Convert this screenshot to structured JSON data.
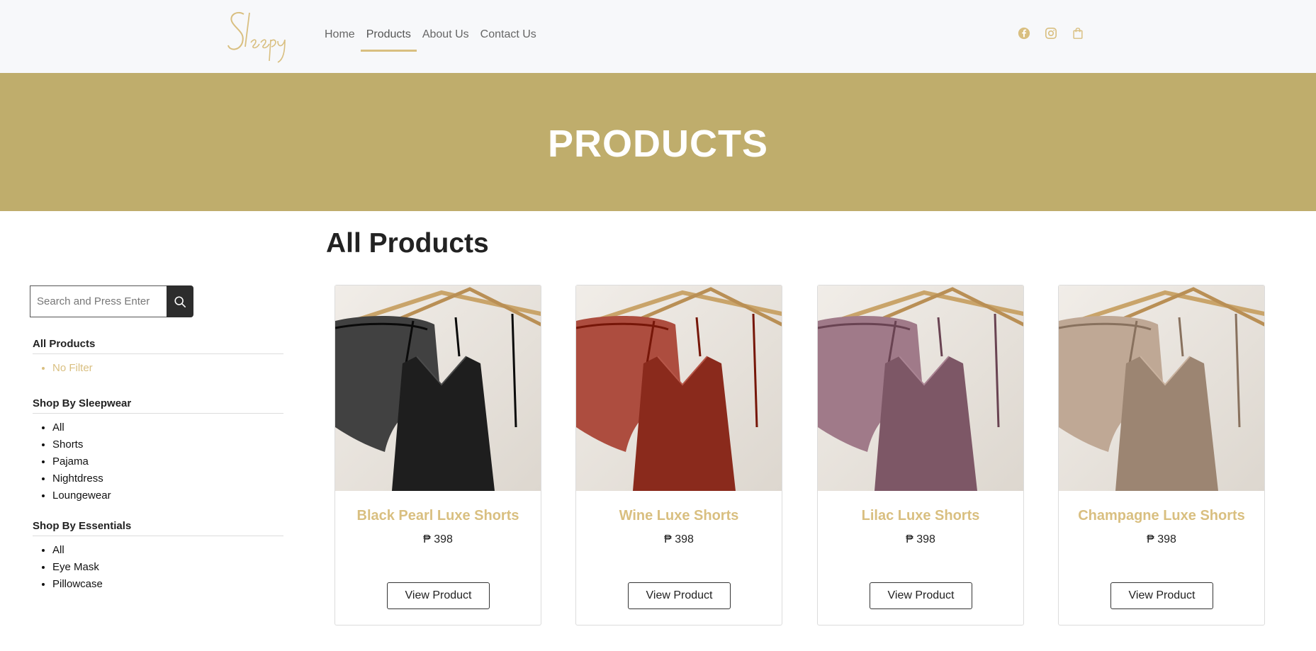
{
  "header": {
    "logo_text": "Sleepy",
    "nav": [
      {
        "label": "Home"
      },
      {
        "label": "Products"
      },
      {
        "label": "About Us"
      },
      {
        "label": "Contact Us"
      }
    ],
    "icons": [
      "facebook-icon",
      "instagram-icon",
      "shopping-bag-icon"
    ]
  },
  "banner": {
    "title": "PRODUCTS"
  },
  "sidebar": {
    "search_placeholder": "Search and Press Enter",
    "groups": [
      {
        "title": "All Products",
        "items": [
          "No Filter"
        ]
      },
      {
        "title": "Shop By Sleepwear",
        "items": [
          "All",
          "Shorts",
          "Pajama",
          "Nightdress",
          "Loungewear"
        ]
      },
      {
        "title": "Shop By Essentials",
        "items": [
          "All",
          "Eye Mask",
          "Pillowcase"
        ]
      }
    ]
  },
  "main": {
    "title": "All Products",
    "products": [
      {
        "name": "Black Pearl Luxe Shorts",
        "price": "₱ 398",
        "button": "View Product",
        "color": "#1e1e1e"
      },
      {
        "name": "Wine Luxe Shorts",
        "price": "₱ 398",
        "button": "View Product",
        "color": "#8a2a1c"
      },
      {
        "name": "Lilac Luxe Shorts",
        "price": "₱ 398",
        "button": "View Product",
        "color": "#7d5766"
      },
      {
        "name": "Champagne Luxe Shorts",
        "price": "₱ 398",
        "button": "View Product",
        "color": "#9c8572"
      }
    ]
  },
  "colors": {
    "accent": "#d9bf80",
    "banner": "#bfad6c",
    "header_bg": "#f7f8fa"
  }
}
